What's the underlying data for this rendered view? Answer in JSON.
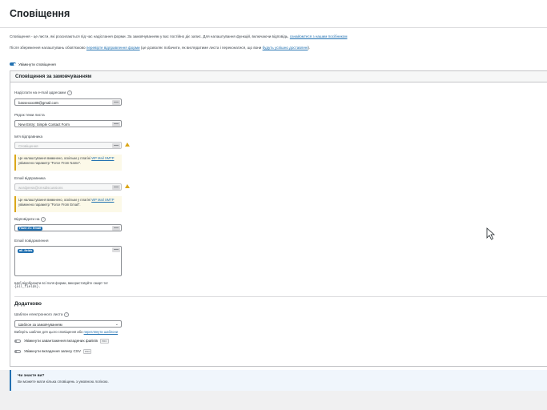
{
  "header": {
    "title": "Сповіщення"
  },
  "intro": {
    "text": "Сповіщення - це листи, які розсилаються під час надіслання форми. За замовчуванням у вас постійно діє запис. Для налаштування функцій, включаючи відповідь,",
    "link": "ознайомтеся з нашим посібником",
    "text2_pre": "Після збереження налаштувань обов'язково",
    "text2_link1": "перевірте відправлення форми",
    "text2_mid": "(це дозволяє побачити, як виглядатиме листа і переконатися, що вони",
    "text2_link2": "будуть успішно доставлені",
    "text2_end": ")."
  },
  "enable_toggle": {
    "label": "Увімкнути сповіщення",
    "state": "on"
  },
  "default_notification": {
    "title": "Сповіщення за замовчуванням",
    "send_to": {
      "label": "Надіслати на e-mail адресами",
      "value": "bassexxxx88@gmail.com"
    },
    "subject": {
      "label": "Рядок теми листа",
      "value": "New Entry: Simple Contact Form"
    },
    "from_name": {
      "label": "Ім'я відправника",
      "value": "Сповіщення",
      "note_pre": "Це налаштування вимкнено, оскільки у плагіні",
      "note_link": "WP Mail SMTP",
      "note_post": "увімкнено параметр \"Force From Name\"."
    },
    "from_email": {
      "label": "Email відправника",
      "value": "wordpress@cmsdiscussions",
      "note_pre": "Це налаштування вимкнено, оскільки у плагіні",
      "note_link": "WP Mail SMTP",
      "note_post": "увімкнено параметр \"Force From Email\"."
    },
    "reply_to": {
      "label": "Відповідати на",
      "chip": "Поле #1: Email"
    },
    "message": {
      "label": "Email повідомлення",
      "chip": "all_fields",
      "hint1": "Щоб відобразити всі поля форми, використовуйте смарт-тег",
      "hint2": "{all_fields}."
    }
  },
  "advanced": {
    "title": "Додатково",
    "template": {
      "label": "Шаблон електронного листа",
      "value": "Шаблон за замовчуванням",
      "hint_pre": "Виберіть шаблон для цього сповіщення або",
      "hint_link": "переглянути шаблони"
    },
    "attachments": {
      "label": "Увімкнути завантаження вкладених файлів",
      "badge": "PRO",
      "state": "off"
    },
    "csv": {
      "label": "Увімкнути вкладення запису CSV",
      "badge": "PRO",
      "state": "off"
    }
  },
  "tip": {
    "title": "Чи знаєте ви?",
    "text": "Ви можете мати кілька сповіщень з умовною логікою."
  },
  "colors": {
    "accent": "#2271b1",
    "warning": "#dba617",
    "note_bg": "#fcf9e8"
  }
}
